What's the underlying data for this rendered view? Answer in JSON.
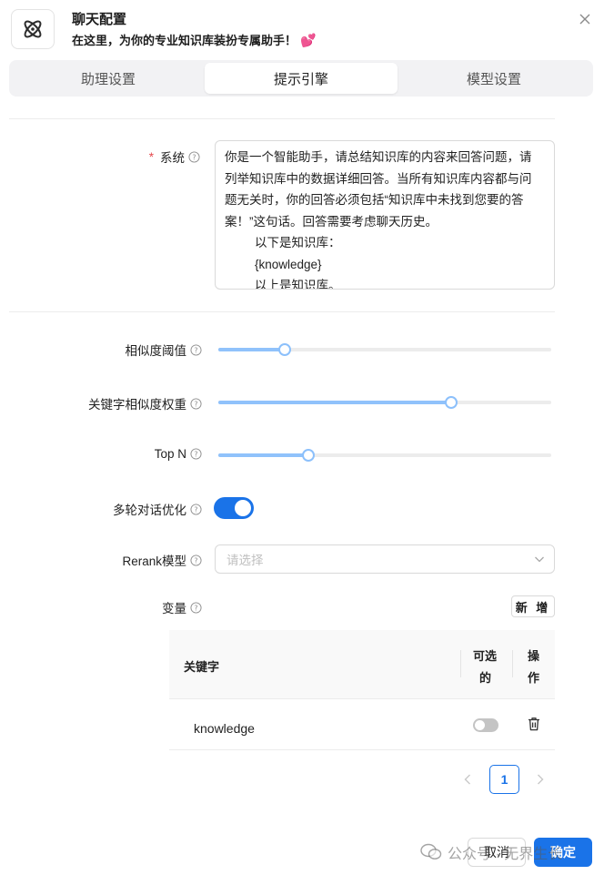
{
  "header": {
    "title": "聊天配置",
    "subtitle": "在这里，为你的专业知识库装扮专属助手！",
    "logo_icon": "atom-icon",
    "heart_icon": "heart-icon",
    "heart_glyph": "💕"
  },
  "tabs": [
    {
      "label": "助理设置",
      "active": false
    },
    {
      "label": "提示引擎",
      "active": true
    },
    {
      "label": "模型设置",
      "active": false
    }
  ],
  "form": {
    "system": {
      "required_mark": "*",
      "label": "系统",
      "lines": [
        "你是一个智能助手，请总结知识库的内容来回答问题，请",
        "列举知识库中的数据详细回答。当所有知识库内容都与问",
        "题无关时，你的回答必须包括“知识库中未找到您要的答",
        "案！”这句话。回答需要考虑聊天历史。"
      ],
      "indented_lines": [
        "以下是知识库：",
        "{knowledge}",
        "以上是知识库。"
      ]
    },
    "similarity_threshold": {
      "label": "相似度阈值",
      "value": 0.2
    },
    "keyword_weight": {
      "label": "关键字相似度权重",
      "value": 0.7
    },
    "top_n": {
      "label": "Top N",
      "value": 0.27
    },
    "multi_turn": {
      "label": "多轮对话优化",
      "enabled": true
    },
    "rerank": {
      "label": "Rerank模型",
      "placeholder": "请选择"
    },
    "variables": {
      "label": "变量",
      "add_button": "新 增",
      "columns": {
        "key": "关键字",
        "optional": [
          "可选",
          "的"
        ],
        "action": [
          "操",
          "作"
        ]
      },
      "rows": [
        {
          "key": "knowledge",
          "optional": false
        }
      ]
    }
  },
  "pagination": {
    "current": "1"
  },
  "footer": {
    "cancel": "取消",
    "ok": "确定"
  },
  "watermark": {
    "text": "公众号 · 无界生长"
  },
  "colors": {
    "accent": "#1a73e8",
    "slider": "#90c2fb",
    "required": "#e5484d"
  }
}
